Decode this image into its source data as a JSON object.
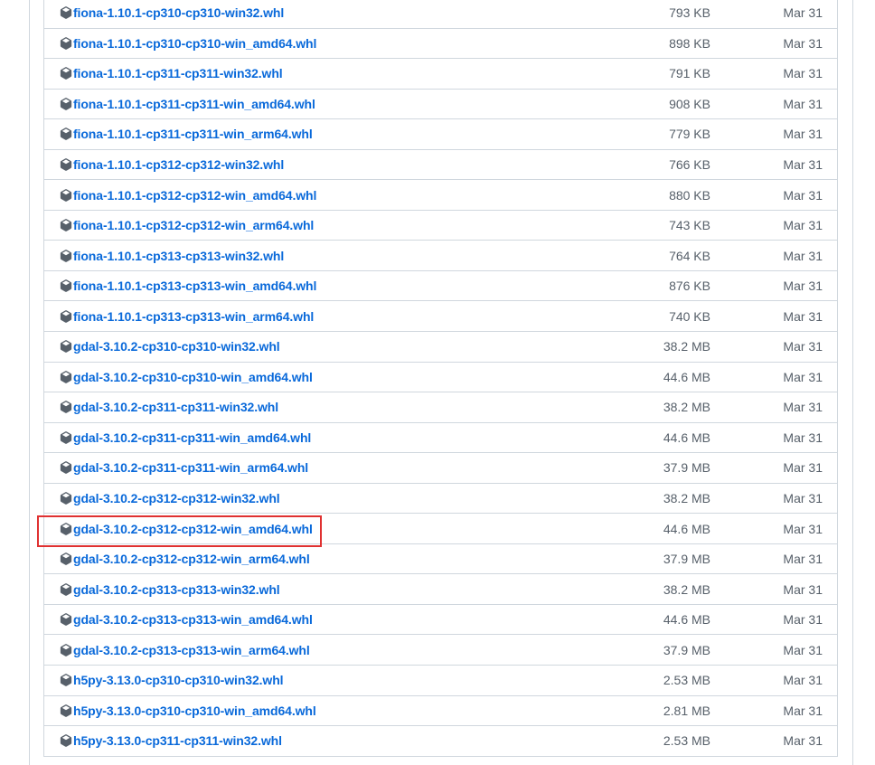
{
  "assets": [
    {
      "name": "fiona-1.10.1-cp310-cp310-win32.whl",
      "size": "793 KB",
      "date": "Mar 31"
    },
    {
      "name": "fiona-1.10.1-cp310-cp310-win_amd64.whl",
      "size": "898 KB",
      "date": "Mar 31"
    },
    {
      "name": "fiona-1.10.1-cp311-cp311-win32.whl",
      "size": "791 KB",
      "date": "Mar 31"
    },
    {
      "name": "fiona-1.10.1-cp311-cp311-win_amd64.whl",
      "size": "908 KB",
      "date": "Mar 31"
    },
    {
      "name": "fiona-1.10.1-cp311-cp311-win_arm64.whl",
      "size": "779 KB",
      "date": "Mar 31"
    },
    {
      "name": "fiona-1.10.1-cp312-cp312-win32.whl",
      "size": "766 KB",
      "date": "Mar 31"
    },
    {
      "name": "fiona-1.10.1-cp312-cp312-win_amd64.whl",
      "size": "880 KB",
      "date": "Mar 31"
    },
    {
      "name": "fiona-1.10.1-cp312-cp312-win_arm64.whl",
      "size": "743 KB",
      "date": "Mar 31"
    },
    {
      "name": "fiona-1.10.1-cp313-cp313-win32.whl",
      "size": "764 KB",
      "date": "Mar 31"
    },
    {
      "name": "fiona-1.10.1-cp313-cp313-win_amd64.whl",
      "size": "876 KB",
      "date": "Mar 31"
    },
    {
      "name": "fiona-1.10.1-cp313-cp313-win_arm64.whl",
      "size": "740 KB",
      "date": "Mar 31"
    },
    {
      "name": "gdal-3.10.2-cp310-cp310-win32.whl",
      "size": "38.2 MB",
      "date": "Mar 31"
    },
    {
      "name": "gdal-3.10.2-cp310-cp310-win_amd64.whl",
      "size": "44.6 MB",
      "date": "Mar 31"
    },
    {
      "name": "gdal-3.10.2-cp311-cp311-win32.whl",
      "size": "38.2 MB",
      "date": "Mar 31"
    },
    {
      "name": "gdal-3.10.2-cp311-cp311-win_amd64.whl",
      "size": "44.6 MB",
      "date": "Mar 31"
    },
    {
      "name": "gdal-3.10.2-cp311-cp311-win_arm64.whl",
      "size": "37.9 MB",
      "date": "Mar 31"
    },
    {
      "name": "gdal-3.10.2-cp312-cp312-win32.whl",
      "size": "38.2 MB",
      "date": "Mar 31"
    },
    {
      "name": "gdal-3.10.2-cp312-cp312-win_amd64.whl",
      "size": "44.6 MB",
      "date": "Mar 31"
    },
    {
      "name": "gdal-3.10.2-cp312-cp312-win_arm64.whl",
      "size": "37.9 MB",
      "date": "Mar 31"
    },
    {
      "name": "gdal-3.10.2-cp313-cp313-win32.whl",
      "size": "38.2 MB",
      "date": "Mar 31"
    },
    {
      "name": "gdal-3.10.2-cp313-cp313-win_amd64.whl",
      "size": "44.6 MB",
      "date": "Mar 31"
    },
    {
      "name": "gdal-3.10.2-cp313-cp313-win_arm64.whl",
      "size": "37.9 MB",
      "date": "Mar 31"
    },
    {
      "name": "h5py-3.13.0-cp310-cp310-win32.whl",
      "size": "2.53 MB",
      "date": "Mar 31"
    },
    {
      "name": "h5py-3.13.0-cp310-cp310-win_amd64.whl",
      "size": "2.81 MB",
      "date": "Mar 31"
    },
    {
      "name": "h5py-3.13.0-cp311-cp311-win32.whl",
      "size": "2.53 MB",
      "date": "Mar 31"
    }
  ],
  "icon": "package-icon",
  "colors": {
    "link": "#0969da",
    "muted": "#57606a",
    "border": "#d0d7de",
    "highlight": "#e03131"
  },
  "highlighted_asset": "gdal-3.10.2-cp312-cp312-win_amd64.whl"
}
